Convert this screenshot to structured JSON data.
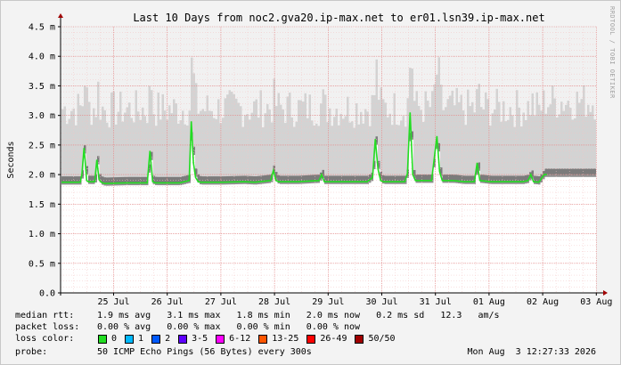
{
  "chart_data": {
    "type": "line",
    "title": "Last 10 Days from noc2.gva20.ip-max.net to er01.lsn39.ip-max.net",
    "ylabel": "Seconds",
    "ylim": [
      0,
      4.5
    ],
    "yticks": [
      "0.0",
      "0.5 m",
      "1.0 m",
      "1.5 m",
      "2.0 m",
      "2.5 m",
      "3.0 m",
      "3.5 m",
      "4.0 m",
      "4.5 m"
    ],
    "xticks": [
      "25 Jul",
      "26 Jul",
      "27 Jul",
      "28 Jul",
      "29 Jul",
      "30 Jul",
      "31 Jul",
      "01 Aug",
      "02 Aug",
      "03 Aug"
    ],
    "grid": true,
    "series": [
      {
        "name": "median rtt",
        "color": "#22dd22",
        "x_days": [
          0.0,
          0.35,
          0.38,
          0.42,
          0.47,
          0.5,
          0.62,
          0.66,
          0.7,
          0.74,
          0.8,
          1.2,
          1.6,
          1.65,
          1.7,
          1.75,
          1.8,
          2.2,
          2.38,
          2.42,
          2.46,
          2.5,
          2.55,
          2.6,
          3.0,
          3.4,
          3.6,
          3.9,
          3.95,
          4.0,
          4.05,
          4.4,
          4.8,
          4.85,
          4.9,
          5.3,
          5.7,
          5.8,
          5.85,
          5.9,
          5.95,
          6.0,
          6.1,
          6.4,
          6.45,
          6.5,
          6.55,
          6.6,
          6.8,
          6.9,
          7.0,
          7.05,
          7.1,
          7.3,
          7.5,
          7.7,
          7.75,
          7.8,
          8.0,
          8.3,
          8.6,
          8.7,
          8.75,
          8.8,
          8.9,
          9.0,
          9.05
        ],
        "values": [
          1.87,
          1.87,
          2.0,
          2.45,
          1.9,
          1.88,
          1.88,
          2.25,
          1.92,
          1.87,
          1.85,
          1.86,
          1.86,
          2.4,
          1.88,
          1.86,
          1.86,
          1.86,
          1.9,
          2.9,
          2.2,
          1.95,
          1.88,
          1.87,
          1.87,
          1.88,
          1.87,
          1.9,
          2.07,
          1.9,
          1.88,
          1.88,
          1.9,
          2.0,
          1.88,
          1.88,
          1.88,
          1.95,
          2.6,
          2.1,
          1.9,
          1.88,
          1.88,
          1.88,
          2.02,
          3.05,
          2.0,
          1.9,
          1.9,
          1.9,
          2.65,
          2.05,
          1.9,
          1.9,
          1.88,
          1.88,
          2.2,
          1.9,
          1.88,
          1.88,
          1.88,
          1.9,
          2.0,
          1.88,
          1.87,
          2.0,
          2.0
        ]
      }
    ]
  },
  "side_label": "RRDTOOL / TOBI OETIKER",
  "stats": {
    "median": {
      "label": "median rtt:",
      "text": "1.9 ms avg   3.1 ms max   1.8 ms min   2.0 ms now   0.2 ms sd   12.3   am/s"
    },
    "loss": {
      "label": "packet loss:",
      "text": "0.00 % avg   0.00 % max   0.00 % min   0.00 % now"
    },
    "loss_color": {
      "label": "loss color:",
      "items": [
        {
          "label": "0",
          "color": "#22dd22"
        },
        {
          "label": "1",
          "color": "#00b8ff"
        },
        {
          "label": "2",
          "color": "#0059ff"
        },
        {
          "label": "3-5",
          "color": "#5e00ff"
        },
        {
          "label": "6-12",
          "color": "#ff00ff"
        },
        {
          "label": "13-25",
          "color": "#ff5500"
        },
        {
          "label": "26-49",
          "color": "#ff0000"
        },
        {
          "label": "50/50",
          "color": "#a00000"
        }
      ]
    },
    "probe": {
      "label": "probe:",
      "text": "50 ICMP Echo Pings (56 Bytes) every 300s",
      "timestamp": "Mon Aug  3 12:27:33 2026"
    }
  }
}
